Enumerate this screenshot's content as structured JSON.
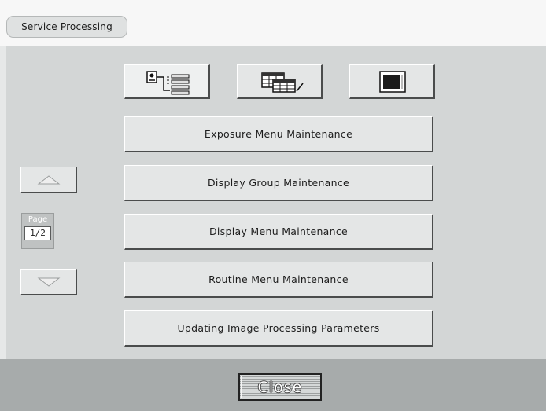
{
  "header": {
    "title": "Service Processing"
  },
  "toolbar": {
    "icons": [
      {
        "name": "process-tree-icon",
        "selected": true
      },
      {
        "name": "tables-edit-icon",
        "selected": false
      },
      {
        "name": "monitor-icon",
        "selected": false
      }
    ]
  },
  "menu": {
    "items": [
      {
        "label": "Exposure Menu Maintenance"
      },
      {
        "label": "Display Group Maintenance"
      },
      {
        "label": "Display Menu Maintenance"
      },
      {
        "label": "Routine Menu Maintenance"
      },
      {
        "label": "Updating Image Processing Parameters"
      }
    ]
  },
  "pager": {
    "label": "Page",
    "value": "1/2"
  },
  "footer": {
    "close_label": "Close"
  }
}
